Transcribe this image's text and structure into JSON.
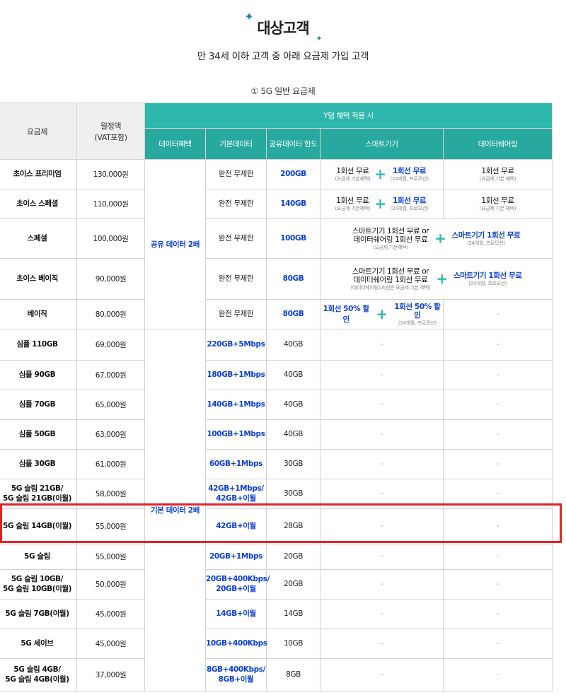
{
  "header": {
    "title": "대상고객",
    "subtitle": "만 34세 이하 고객 중 아래 요금제 가입 고객",
    "section_label": "① 5G 일반 요금제",
    "accent_color": "#2eb7ac",
    "highlight_color": "#0a3fd8"
  },
  "table": {
    "headers": {
      "plan": "요금제",
      "fee_line1": "월정액",
      "fee_line2": "(VAT포함)",
      "ydum": "Y덤 혜택 적용 시",
      "data_benefit": "데이터혜택",
      "basic_data": "기본데이터",
      "shared_data": "공유데이터 한도",
      "smart_device": "스마트기기",
      "data_sharing": "데이터쉐어링"
    },
    "merge_benefit_1": "공유 데이터 2배",
    "merge_benefit_2": "기본 데이터 2배",
    "dash": "-",
    "premium_rows": [
      {
        "plan": "초이스 프리미엄",
        "price": "130,000원",
        "basic": "완전 무제한",
        "shared": "200GB",
        "sd_left_main": "1회선 무료",
        "sd_left_sub": "(요금제 기본혜택)",
        "sd_right_main": "1회선 무료",
        "sd_right_sub": "(24개월, 프로모션)",
        "ds_main": "1회선 무료",
        "ds_sub": "(요금제 기본 혜택)"
      },
      {
        "plan": "초이스 스페셜",
        "price": "110,000원",
        "basic": "완전 무제한",
        "shared": "140GB",
        "sd_left_main": "1회선 무료",
        "sd_left_sub": "(요금제 기본혜택)",
        "sd_right_main": "1회선 무료",
        "sd_right_sub": "(24개월, 프로모션)",
        "ds_main": "1회선 무료",
        "ds_sub": "(요금제 기본 혜택)"
      }
    ],
    "special_row": {
      "plan": "스페셜",
      "price": "100,000원",
      "basic": "완전 무제한",
      "shared": "100GB",
      "left_l1": "스마트기기 1회선 무료 or",
      "left_l2": "데이터쉐어링 1회선 무료",
      "left_sub": "(요금제 기본혜택)",
      "right_main": "스마트기기 1회선 무료",
      "right_sub": "(24개월, 프로모션)"
    },
    "choice_basic_row": {
      "plan": "초이스 베이직",
      "price": "90,000원",
      "basic": "완전 무제한",
      "shared": "80GB",
      "left_l1": "스마트기기 1회선 무료 or",
      "left_l2": "데이터쉐어링 1회선 무료",
      "left_sub": "(데이터쉐어링1회선은 요금제 기본 혜택)",
      "right_main": "스마트기기 1회선 무료",
      "right_sub": "(24개월, 프로모션)"
    },
    "basic_row": {
      "plan": "베이직",
      "price": "80,000원",
      "basic": "완전 무제한",
      "shared": "80GB",
      "left_main": "1회선 50% 할인",
      "right_main": "1회선 50% 할인",
      "right_sub": "(24개월, 프로모션)",
      "ds": "-"
    },
    "simple_rows": [
      {
        "plan": "심플 110GB",
        "price": "69,000원",
        "basic": "220GB+5Mbps",
        "shared": "40GB"
      },
      {
        "plan": "심플 90GB",
        "price": "67,000원",
        "basic": "180GB+1Mbps",
        "shared": "40GB"
      },
      {
        "plan": "심플 70GB",
        "price": "65,000원",
        "basic": "140GB+1Mbps",
        "shared": "40GB"
      },
      {
        "plan": "심플 50GB",
        "price": "63,000원",
        "basic": "100GB+1Mbps",
        "shared": "40GB"
      },
      {
        "plan": "심플 30GB",
        "price": "61,000원",
        "basic": "60GB+1Mbps",
        "shared": "30GB"
      },
      {
        "plan1": "5G 슬림 21GB/",
        "plan2": "5G 슬림 21GB(이월)",
        "price": "58,000원",
        "basic1": "42GB+1Mbps/",
        "basic2": "42GB+이월",
        "shared": "30GB"
      },
      {
        "plan": "5G 슬림 14GB(이월)",
        "price": "55,000원",
        "basic": "42GB+이월",
        "shared": "28GB"
      }
    ],
    "slim_rows": [
      {
        "plan": "5G 슬림",
        "price": "55,000원",
        "basic": "20GB+1Mbps",
        "shared": "20GB"
      },
      {
        "plan1": "5G 슬림 10GB/",
        "plan2": "5G 슬림 10GB(이월)",
        "price": "50,000원",
        "basic1": "20GB+400Kbps/",
        "basic2": "20GB+이월",
        "shared": "20GB"
      },
      {
        "plan": "5G 슬림 7GB(이월)",
        "price": "45,000원",
        "basic": "14GB+이월",
        "shared": "14GB"
      },
      {
        "plan": "5G 세이브",
        "price": "45,000원",
        "basic": "10GB+400Kbps",
        "shared": "10GB"
      },
      {
        "plan1": "5G 슬림 4GB/",
        "plan2": "5G 슬림 4GB(이월)",
        "price": "37,000원",
        "basic1": "8GB+400Kbps/",
        "basic2": "8GB+이월",
        "shared": "8GB"
      }
    ]
  }
}
